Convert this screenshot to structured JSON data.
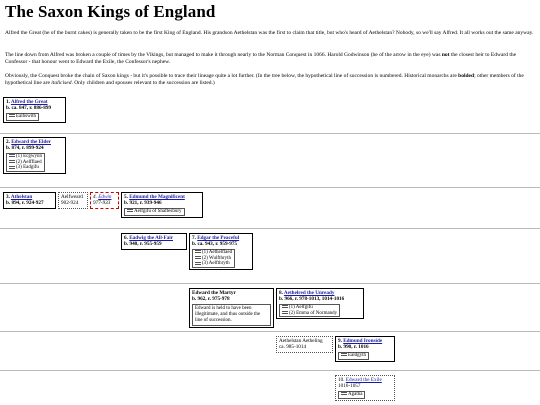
{
  "title": "The Saxon Kings of England",
  "paragraphs": [
    "Alfred the Great (he of the burnt cakes) is generally taken to be the first King of England. His grandson Aethelstan was the first to claim that title, but who's heard of Aethelstan? Nobody, so we'll say Alfred. It all works out the same anyway.",
    "The line down from Alfred was broken a couple of times by the Vikings, but managed to make it through nearly to the Norman Conquest in 1066. Harold Godwinson (he of the arrow in the eye) was not the closest heir to Edward the Confessor - that honour went to Edward the Exile, the Confessor's nephew.",
    "Obviously, the Conquest broke the chain of Saxon kings - but it's possible to trace their lineage quite a lot further. (In the tree below, the hypothetical line of succession is numbered. Historical monarchs are bolded; other members of the hypothetical line are italicised. Only children and spouses relevant to the succession are listed.)"
  ],
  "p2_parts": {
    "a": "The line down from Alfred was broken a couple of times by the Vikings, but managed to make it through nearly to the Norman Conquest in 1066. Harold Godwinson (he of the arrow in the eye) was ",
    "b": "not",
    "c": " the closest heir to Edward the Confessor - that honour went to Edward the Exile, the Confessor's nephew."
  },
  "p3_parts": {
    "a": "Obviously, the Conquest broke the chain of Saxon kings - but it's possible to trace their lineage quite a lot further. (In the tree below, the hypothetical line of succession is numbered. Historical monarchs are ",
    "b": "bolded",
    "c": "; other members of the hypothetical line are ",
    "d": "italicised",
    "e": ". Only children and spouses relevant to the succession are listed.)"
  },
  "tree": {
    "alfred": {
      "num": "1.",
      "name": "Alfred the Great",
      "dates": "b. ca. 847, r. 886-899",
      "spouses": [
        "Ealhswith"
      ]
    },
    "edward_elder": {
      "num": "2.",
      "name": "Edward the Elder",
      "dates": "b. 874, r. 899-924",
      "spouses": [
        "(1) Ecgwynn",
        "(2) Aelfflaed",
        "(3) Eadgifu"
      ]
    },
    "athelstan": {
      "num": "3.",
      "name": "Athelstan",
      "dates": "b. 894, r. 924-927"
    },
    "aelfweard": {
      "name": "Aelfweard",
      "dates": "902-924"
    },
    "edwin": {
      "num": "4.",
      "name": "Edwin",
      "dates": "977-933"
    },
    "edmund": {
      "num": "5.",
      "name": "Edmund the Magnificent",
      "dates": "b. 921, r. 939-946",
      "spouses": [
        "Aelfgifu of Shaftesbury"
      ]
    },
    "eadwig": {
      "num": "6.",
      "name": "Eadwig the All-Fair",
      "dates": "b. 940, r. 955-959"
    },
    "edgar": {
      "num": "7.",
      "name": "Edgar the Peaceful",
      "dates": "b. ca. 943, r. 959-975",
      "spouses": [
        "(1) Aethelflaed",
        "(2) Wulfthryth",
        "(3) Aelfthryth"
      ]
    },
    "edward_martyr": {
      "name": "Edward the Martyr",
      "dates": "b. 962, r. 975-978",
      "note": "Edward is held to have been illegitimate, and thus outside the line of succession."
    },
    "aethelred": {
      "num": "8.",
      "name": "Aethelred the Unready",
      "dates": "b. 966, r. 978-1013, 1014-1016",
      "spouses": [
        "(1) Aelfgifu",
        "(2) Emma of Normandy"
      ]
    },
    "aethelstan_aetheling": {
      "name": "Aethelstan Aetheling",
      "dates": "ca. 985-1014"
    },
    "edmund_ironside": {
      "num": "9.",
      "name": "Edmund Ironside",
      "dates": "b. 990, r. 1016",
      "spouses": [
        "Ealdgyth"
      ]
    },
    "edward_exile": {
      "num": "10.",
      "name": "Edward the Exile",
      "dates": "1016-1057",
      "spouses": [
        "Agatha"
      ]
    }
  }
}
